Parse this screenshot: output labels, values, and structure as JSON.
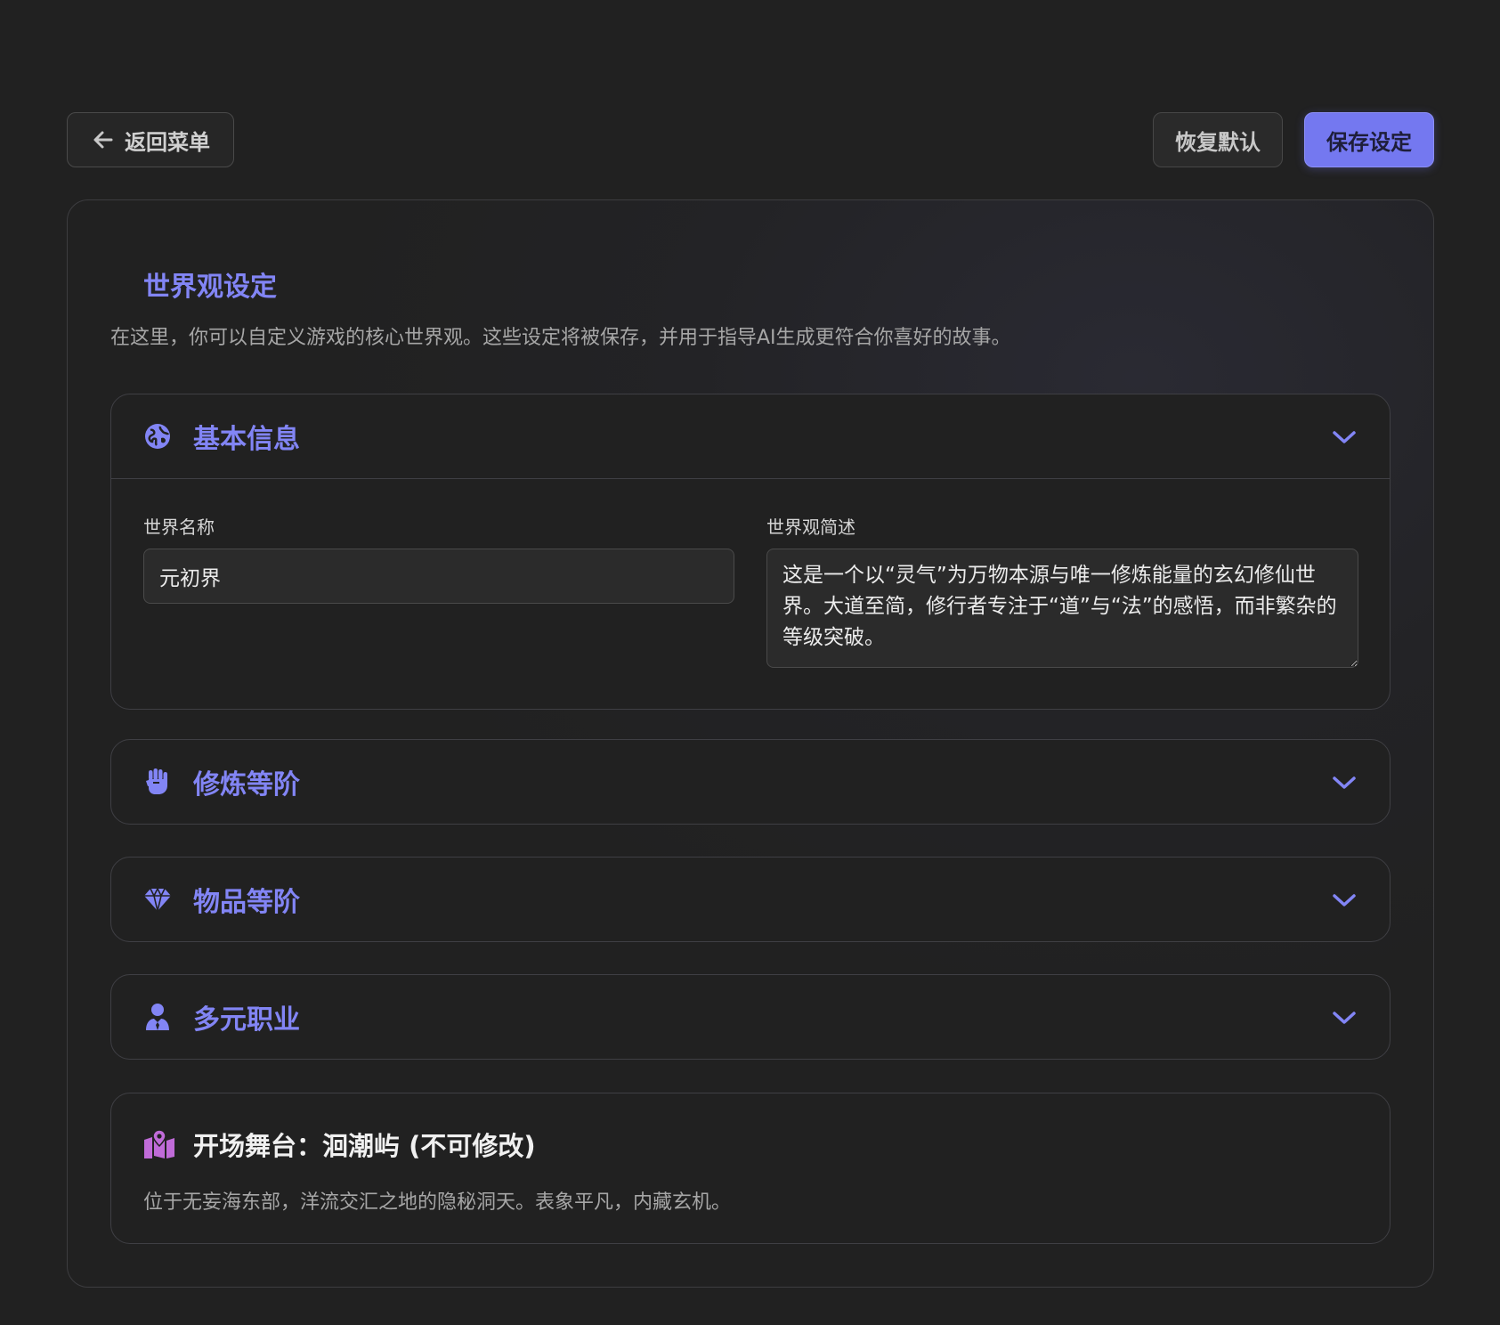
{
  "toolbar": {
    "back_label": "返回菜单",
    "reset_label": "恢复默认",
    "save_label": "保存设定"
  },
  "panel": {
    "title": "世界观设定",
    "description": "在这里，你可以自定义游戏的核心世界观。这些设定将被保存，并用于指导AI生成更符合你喜好的故事。"
  },
  "sections": {
    "basic": {
      "label": "基本信息",
      "icon": "globe-icon",
      "expanded": true,
      "world_name_label": "世界名称",
      "world_name_value": "元初界",
      "summary_label": "世界观简述",
      "summary_value": "这是一个以“灵气”为万物本源与唯一修炼能量的玄幻修仙世界。大道至简，修行者专注于“道”与“法”的感悟，而非繁杂的等级突破。"
    },
    "cultivation": {
      "label": "修炼等阶",
      "icon": "fist-icon",
      "expanded": false
    },
    "items": {
      "label": "物品等阶",
      "icon": "gem-icon",
      "expanded": false
    },
    "professions": {
      "label": "多元职业",
      "icon": "user-tie-icon",
      "expanded": false
    }
  },
  "stage": {
    "title": "开场舞台：洄潮屿 (不可修改)",
    "description": "位于无妄海东部，洋流交汇之地的隐秘洞天。表象平凡，内藏玄机。",
    "icon": "map-location-icon"
  },
  "colors": {
    "accent": "#8285f5",
    "save_button": "#7478f0",
    "stage_icon": "#c06bd8",
    "background": "#212121"
  }
}
